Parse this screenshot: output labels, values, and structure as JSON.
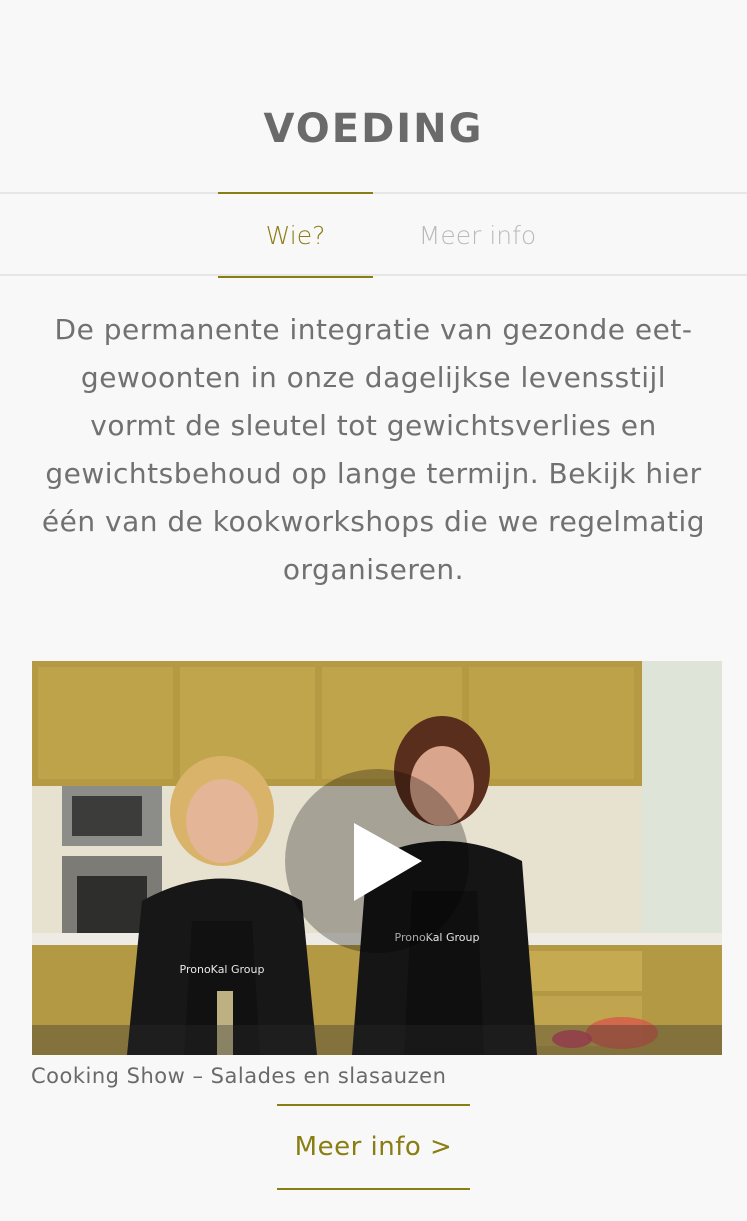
{
  "page": {
    "title": "VOEDING"
  },
  "tabs": [
    {
      "label": "Wie?",
      "active": true
    },
    {
      "label": "Meer info",
      "active": false
    }
  ],
  "intro": {
    "text": "De permanente integratie van gezonde eet-gewoonten in onze dagelijkse levensstijl vormt de sleutel tot gewichtsverlies en gewichtsbehoud op lange termijn. Bekijk hier één van de kookworkshops die we regelmatig organiseren."
  },
  "video": {
    "caption": "Cooking Show – Salades en slasauzen",
    "play_icon": "play-icon",
    "apron_text": "PronoKal Group"
  },
  "cta": {
    "label": "Meer info >"
  },
  "colors": {
    "accent": "#8a7d12",
    "text": "#6d6d6d",
    "inactive_tab": "#b9b9b9",
    "background": "#f8f8f8"
  }
}
